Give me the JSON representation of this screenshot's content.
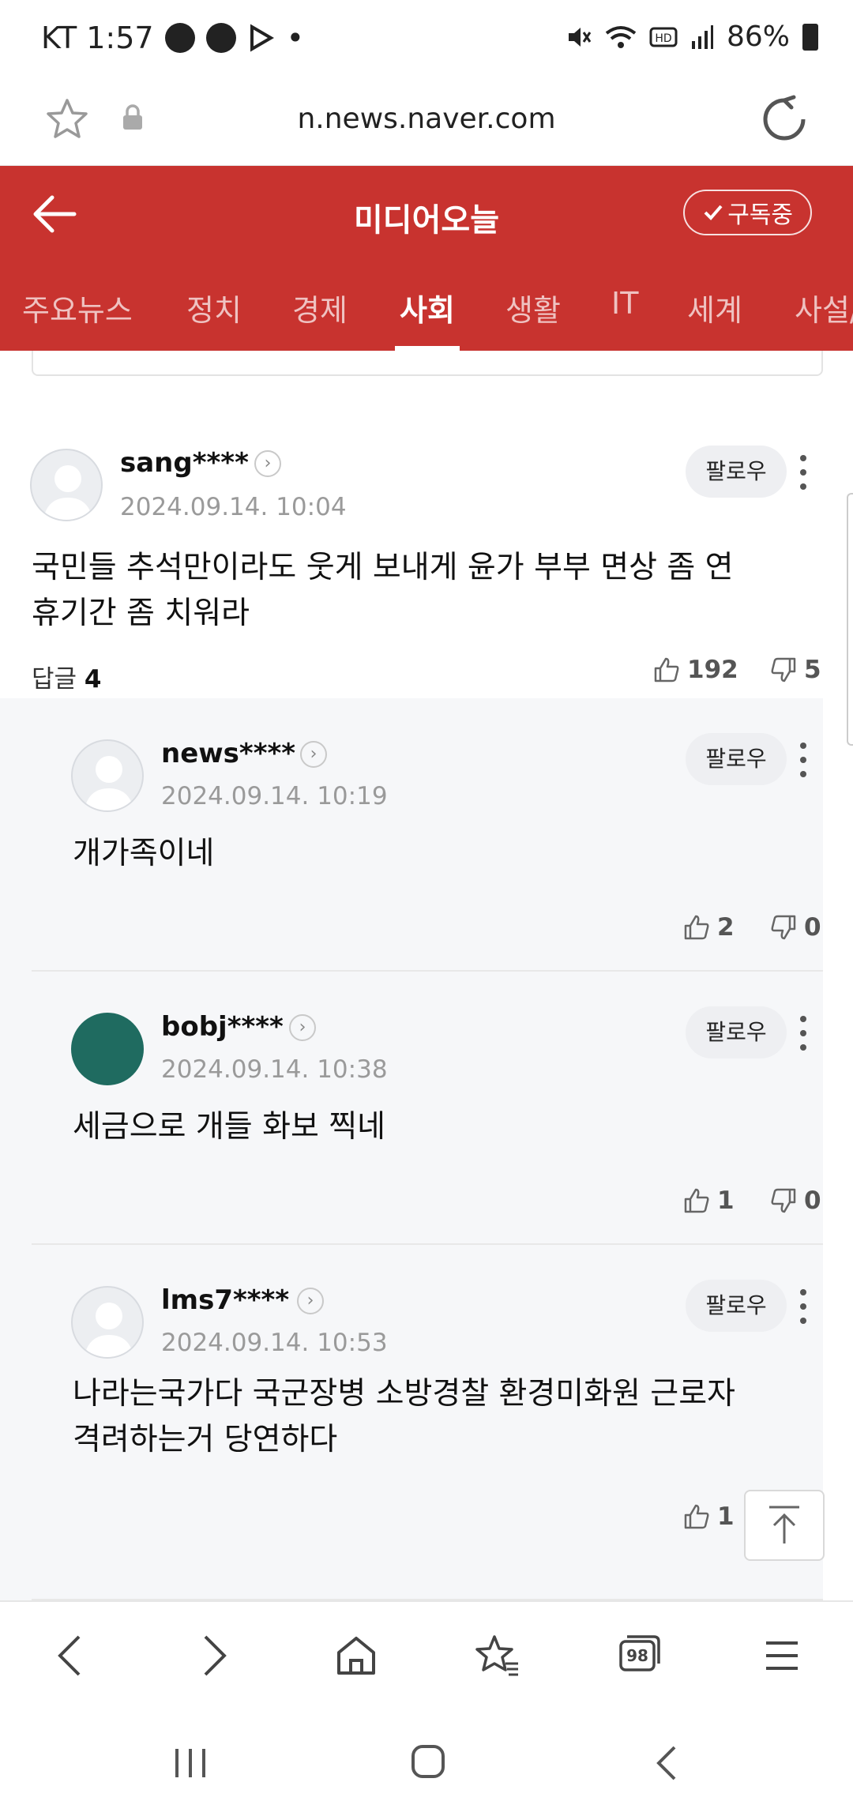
{
  "status_bar": {
    "carrier_time": "KT 1:57",
    "extra_dot": "•",
    "battery": "86%"
  },
  "url_bar": {
    "url": "n.news.naver.com"
  },
  "header": {
    "title": "미디어오늘",
    "subscribe_label": "구독중"
  },
  "tabs": [
    "주요뉴스",
    "정치",
    "경제",
    "사회",
    "생활",
    "IT",
    "세계",
    "사설/"
  ],
  "active_tab": "사회",
  "comments": [
    {
      "user": "sang****",
      "date": "2024.09.14. 10:04",
      "text_line1": "국민들 추석만이라도 웃게 보내게 윤가 부부 면상 좀 연",
      "text_line2": "휴기간 좀 치워라",
      "replies_label": "답글",
      "replies_count": "4",
      "likes": "192",
      "dislikes": "5",
      "follow_label": "팔로우"
    },
    {
      "user": "news****",
      "date": "2024.09.14. 10:19",
      "text": "개가족이네",
      "likes": "2",
      "dislikes": "0",
      "follow_label": "팔로우"
    },
    {
      "user": "bobj****",
      "date": "2024.09.14. 10:38",
      "text": "세금으로 개들 화보 찍네",
      "likes": "1",
      "dislikes": "0",
      "follow_label": "팔로우"
    },
    {
      "user": "lms7****",
      "date": "2024.09.14. 10:53",
      "text_line1": "나라는국가다 국군장병 소방경찰 환경미화원 근로자",
      "text_line2": "격려하는거 당연하다",
      "likes": "1",
      "follow_label": "팔로우"
    }
  ],
  "bottom_nav": {
    "tabs_count": "98"
  },
  "colors": {
    "brand_red": "#c8332f",
    "reply_bg": "#f6f7f9"
  }
}
